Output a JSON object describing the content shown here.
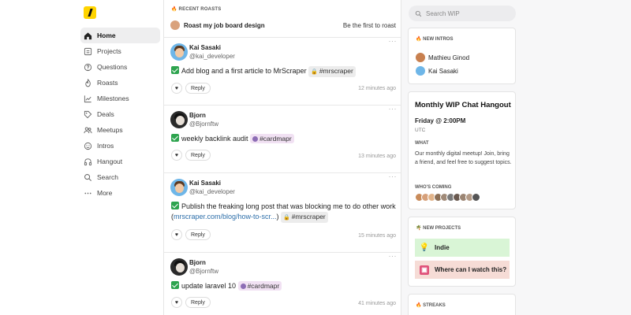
{
  "nav": {
    "items": [
      {
        "label": "Home",
        "icon": "home-icon"
      },
      {
        "label": "Projects",
        "icon": "folder-icon"
      },
      {
        "label": "Questions",
        "icon": "question-icon"
      },
      {
        "label": "Roasts",
        "icon": "flame-icon"
      },
      {
        "label": "Milestones",
        "icon": "chart-icon"
      },
      {
        "label": "Deals",
        "icon": "tag-icon"
      },
      {
        "label": "Meetups",
        "icon": "people-icon"
      },
      {
        "label": "Intros",
        "icon": "smile-icon"
      },
      {
        "label": "Hangout",
        "icon": "headphones-icon"
      },
      {
        "label": "Search",
        "icon": "search-icon"
      },
      {
        "label": "More",
        "icon": "more-icon"
      }
    ]
  },
  "roasts": {
    "label": "RECENT ROASTS",
    "title": "Roast my job board design",
    "cta": "Be the first to roast"
  },
  "posts": [
    {
      "name": "Kai Sasaki",
      "handle": "@kai_developer",
      "text": "Add blog and a first article to MrScraper",
      "tag": "#mrscraper",
      "time": "12 minutes ago",
      "reply": "Reply"
    },
    {
      "name": "Bjorn",
      "handle": "@Bjornftw",
      "text": "weekly backlink audit",
      "tag": "#cardmapr",
      "time": "13 minutes ago",
      "reply": "Reply"
    },
    {
      "name": "Kai Sasaki",
      "handle": "@kai_developer",
      "text": "Publish the freaking long post that was blocking me to do other work",
      "link_open": "(",
      "link": "mrscraper.com/blog/how-to-scr...",
      "link_close": ")",
      "tag": "#mrscraper",
      "time": "15 minutes ago",
      "reply": "Reply"
    },
    {
      "name": "Bjorn",
      "handle": "@Bjornftw",
      "text": "update laravel 10",
      "tag": "#cardmapr",
      "time": "41 minutes ago",
      "reply": "Reply"
    }
  ],
  "search": {
    "placeholder": "Search WIP"
  },
  "intros": {
    "label": "NEW INTROS",
    "people": [
      "Mathieu Ginod",
      "Kai Sasaki"
    ]
  },
  "hangout": {
    "title": "Monthly WIP Chat Hangout",
    "time": "Friday @ 2:00PM",
    "tz": "UTC",
    "what_label": "WHAT",
    "description": "Our monthly digital meetup! Join, bring a friend, and feel free to suggest topics.",
    "who_label": "WHO'S COMING"
  },
  "new_projects": {
    "label": "NEW PROJECTS",
    "items": [
      "Indie",
      "Where can I watch this?"
    ]
  },
  "streaks": {
    "label": "STREAKS"
  },
  "colors": {
    "logo": "#ffd400",
    "check": "#2ea44f",
    "link": "#2c6ea9",
    "project_green": "#d9f5d6",
    "project_red": "#f6dcd6"
  }
}
